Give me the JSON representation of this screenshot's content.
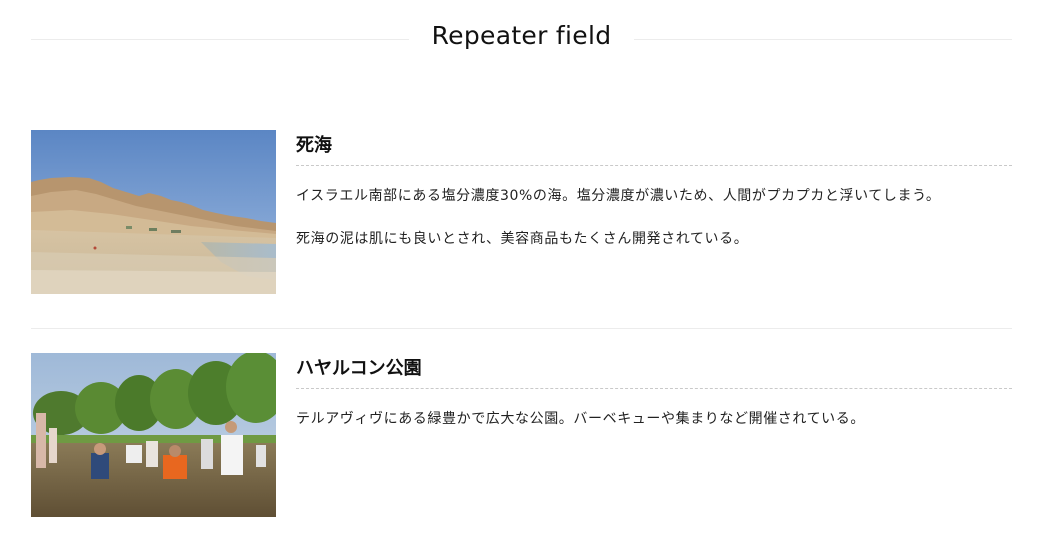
{
  "section": {
    "title": "Repeater field"
  },
  "entries": [
    {
      "heading": "死海",
      "paragraphs": [
        "イスラエル南部にある塩分濃度30%の海。塩分濃度が濃いため、人間がプカプカと浮いてしまう。",
        "死海の泥は肌にも良いとされ、美容商品もたくさん開発されている。"
      ],
      "image": "dead-sea-photo"
    },
    {
      "heading": "ハヤルコン公園",
      "paragraphs": [
        "テルアヴィヴにある緑豊かで広大な公園。バーベキューや集まりなど開催されている。"
      ],
      "image": "hayarkon-park-photo"
    }
  ]
}
